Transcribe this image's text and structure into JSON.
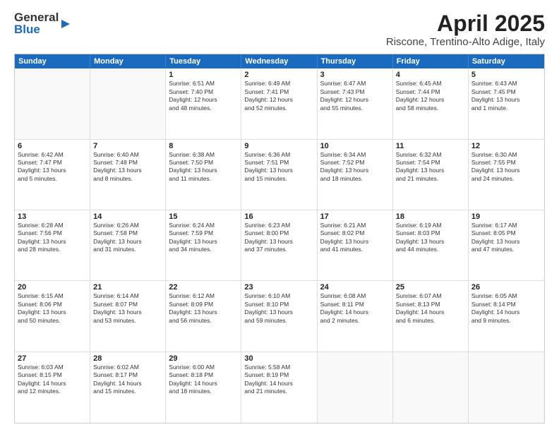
{
  "header": {
    "logo_general": "General",
    "logo_blue": "Blue",
    "title": "April 2025",
    "subtitle": "Riscone, Trentino-Alto Adige, Italy"
  },
  "calendar": {
    "days": [
      "Sunday",
      "Monday",
      "Tuesday",
      "Wednesday",
      "Thursday",
      "Friday",
      "Saturday"
    ],
    "weeks": [
      [
        {
          "num": "",
          "info": "",
          "empty": true
        },
        {
          "num": "",
          "info": "",
          "empty": true
        },
        {
          "num": "1",
          "info": "Sunrise: 6:51 AM\nSunset: 7:40 PM\nDaylight: 12 hours\nand 48 minutes.",
          "empty": false
        },
        {
          "num": "2",
          "info": "Sunrise: 6:49 AM\nSunset: 7:41 PM\nDaylight: 12 hours\nand 52 minutes.",
          "empty": false
        },
        {
          "num": "3",
          "info": "Sunrise: 6:47 AM\nSunset: 7:43 PM\nDaylight: 12 hours\nand 55 minutes.",
          "empty": false
        },
        {
          "num": "4",
          "info": "Sunrise: 6:45 AM\nSunset: 7:44 PM\nDaylight: 12 hours\nand 58 minutes.",
          "empty": false
        },
        {
          "num": "5",
          "info": "Sunrise: 6:43 AM\nSunset: 7:45 PM\nDaylight: 13 hours\nand 1 minute.",
          "empty": false
        }
      ],
      [
        {
          "num": "6",
          "info": "Sunrise: 6:42 AM\nSunset: 7:47 PM\nDaylight: 13 hours\nand 5 minutes.",
          "empty": false
        },
        {
          "num": "7",
          "info": "Sunrise: 6:40 AM\nSunset: 7:48 PM\nDaylight: 13 hours\nand 8 minutes.",
          "empty": false
        },
        {
          "num": "8",
          "info": "Sunrise: 6:38 AM\nSunset: 7:50 PM\nDaylight: 13 hours\nand 11 minutes.",
          "empty": false
        },
        {
          "num": "9",
          "info": "Sunrise: 6:36 AM\nSunset: 7:51 PM\nDaylight: 13 hours\nand 15 minutes.",
          "empty": false
        },
        {
          "num": "10",
          "info": "Sunrise: 6:34 AM\nSunset: 7:52 PM\nDaylight: 13 hours\nand 18 minutes.",
          "empty": false
        },
        {
          "num": "11",
          "info": "Sunrise: 6:32 AM\nSunset: 7:54 PM\nDaylight: 13 hours\nand 21 minutes.",
          "empty": false
        },
        {
          "num": "12",
          "info": "Sunrise: 6:30 AM\nSunset: 7:55 PM\nDaylight: 13 hours\nand 24 minutes.",
          "empty": false
        }
      ],
      [
        {
          "num": "13",
          "info": "Sunrise: 6:28 AM\nSunset: 7:56 PM\nDaylight: 13 hours\nand 28 minutes.",
          "empty": false
        },
        {
          "num": "14",
          "info": "Sunrise: 6:26 AM\nSunset: 7:58 PM\nDaylight: 13 hours\nand 31 minutes.",
          "empty": false
        },
        {
          "num": "15",
          "info": "Sunrise: 6:24 AM\nSunset: 7:59 PM\nDaylight: 13 hours\nand 34 minutes.",
          "empty": false
        },
        {
          "num": "16",
          "info": "Sunrise: 6:23 AM\nSunset: 8:00 PM\nDaylight: 13 hours\nand 37 minutes.",
          "empty": false
        },
        {
          "num": "17",
          "info": "Sunrise: 6:21 AM\nSunset: 8:02 PM\nDaylight: 13 hours\nand 41 minutes.",
          "empty": false
        },
        {
          "num": "18",
          "info": "Sunrise: 6:19 AM\nSunset: 8:03 PM\nDaylight: 13 hours\nand 44 minutes.",
          "empty": false
        },
        {
          "num": "19",
          "info": "Sunrise: 6:17 AM\nSunset: 8:05 PM\nDaylight: 13 hours\nand 47 minutes.",
          "empty": false
        }
      ],
      [
        {
          "num": "20",
          "info": "Sunrise: 6:15 AM\nSunset: 8:06 PM\nDaylight: 13 hours\nand 50 minutes.",
          "empty": false
        },
        {
          "num": "21",
          "info": "Sunrise: 6:14 AM\nSunset: 8:07 PM\nDaylight: 13 hours\nand 53 minutes.",
          "empty": false
        },
        {
          "num": "22",
          "info": "Sunrise: 6:12 AM\nSunset: 8:09 PM\nDaylight: 13 hours\nand 56 minutes.",
          "empty": false
        },
        {
          "num": "23",
          "info": "Sunrise: 6:10 AM\nSunset: 8:10 PM\nDaylight: 13 hours\nand 59 minutes.",
          "empty": false
        },
        {
          "num": "24",
          "info": "Sunrise: 6:08 AM\nSunset: 8:11 PM\nDaylight: 14 hours\nand 2 minutes.",
          "empty": false
        },
        {
          "num": "25",
          "info": "Sunrise: 6:07 AM\nSunset: 8:13 PM\nDaylight: 14 hours\nand 6 minutes.",
          "empty": false
        },
        {
          "num": "26",
          "info": "Sunrise: 6:05 AM\nSunset: 8:14 PM\nDaylight: 14 hours\nand 9 minutes.",
          "empty": false
        }
      ],
      [
        {
          "num": "27",
          "info": "Sunrise: 6:03 AM\nSunset: 8:15 PM\nDaylight: 14 hours\nand 12 minutes.",
          "empty": false
        },
        {
          "num": "28",
          "info": "Sunrise: 6:02 AM\nSunset: 8:17 PM\nDaylight: 14 hours\nand 15 minutes.",
          "empty": false
        },
        {
          "num": "29",
          "info": "Sunrise: 6:00 AM\nSunset: 8:18 PM\nDaylight: 14 hours\nand 18 minutes.",
          "empty": false
        },
        {
          "num": "30",
          "info": "Sunrise: 5:58 AM\nSunset: 8:19 PM\nDaylight: 14 hours\nand 21 minutes.",
          "empty": false
        },
        {
          "num": "",
          "info": "",
          "empty": true
        },
        {
          "num": "",
          "info": "",
          "empty": true
        },
        {
          "num": "",
          "info": "",
          "empty": true
        }
      ]
    ]
  }
}
